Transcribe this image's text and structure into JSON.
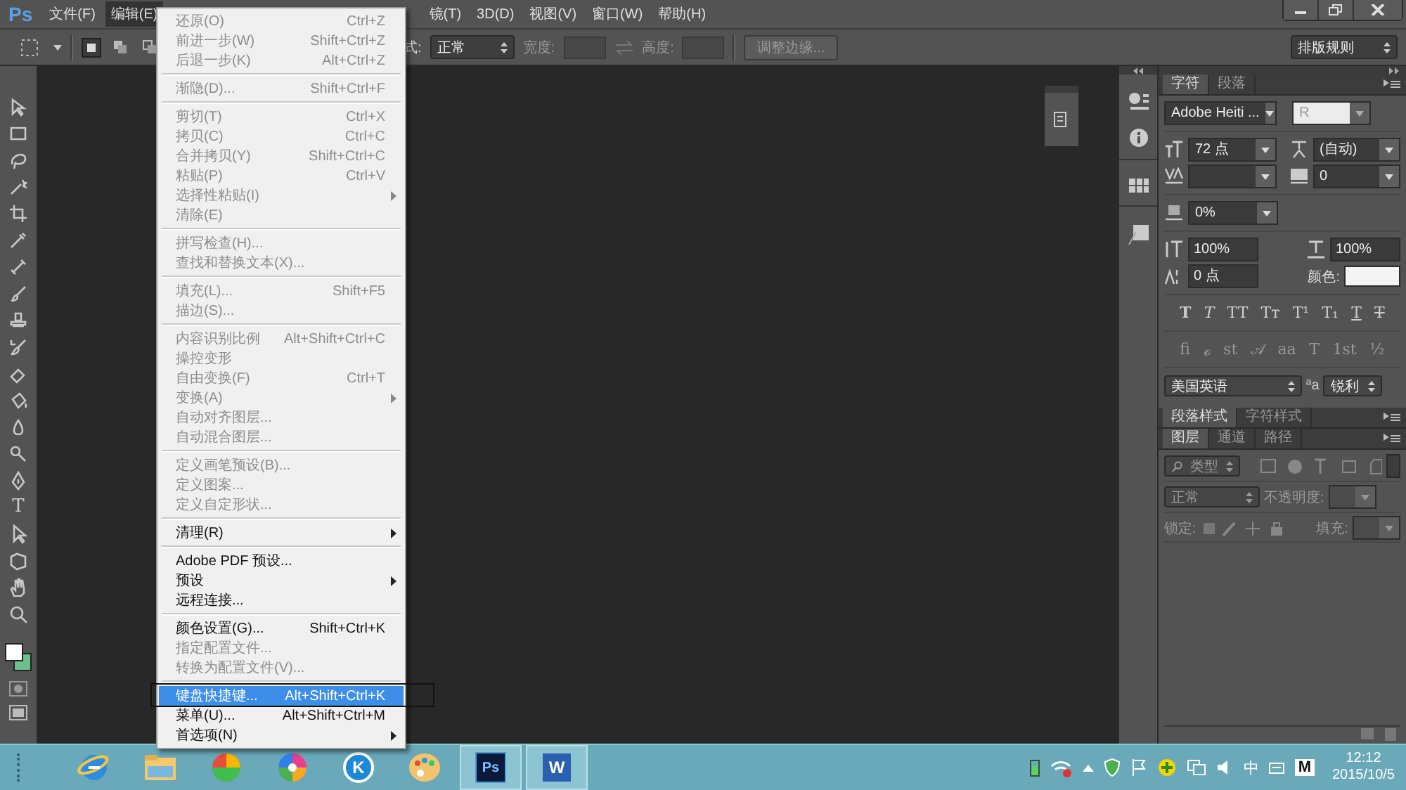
{
  "app": {
    "logo": "Ps"
  },
  "menubar": [
    {
      "label": "文件(F)",
      "selected": false
    },
    {
      "label": "编辑(E)",
      "selected": true
    },
    {
      "label": "镜(T)",
      "selected": false
    },
    {
      "label": "3D(D)",
      "selected": false
    },
    {
      "label": "视图(V)",
      "selected": false
    },
    {
      "label": "窗口(W)",
      "selected": false
    },
    {
      "label": "帮助(H)",
      "selected": false
    }
  ],
  "options_bar": {
    "style_label": "式:",
    "style_value": "正常",
    "width_label": "宽度:",
    "height_label": "高度:",
    "refine_button": "调整边缘...",
    "typography_select": "排版规则"
  },
  "edit_menu": {
    "groups": [
      {
        "items": [
          {
            "label": "还原(O)",
            "shortcut": "Ctrl+Z",
            "disabled": true,
            "submenu": false,
            "selected": false
          },
          {
            "label": "前进一步(W)",
            "shortcut": "Shift+Ctrl+Z",
            "disabled": true,
            "submenu": false,
            "selected": false
          },
          {
            "label": "后退一步(K)",
            "shortcut": "Alt+Ctrl+Z",
            "disabled": true,
            "submenu": false,
            "selected": false
          }
        ]
      },
      {
        "items": [
          {
            "label": "渐隐(D)...",
            "shortcut": "Shift+Ctrl+F",
            "disabled": true,
            "submenu": false,
            "selected": false
          }
        ]
      },
      {
        "items": [
          {
            "label": "剪切(T)",
            "shortcut": "Ctrl+X",
            "disabled": true,
            "submenu": false,
            "selected": false
          },
          {
            "label": "拷贝(C)",
            "shortcut": "Ctrl+C",
            "disabled": true,
            "submenu": false,
            "selected": false
          },
          {
            "label": "合并拷贝(Y)",
            "shortcut": "Shift+Ctrl+C",
            "disabled": true,
            "submenu": false,
            "selected": false
          },
          {
            "label": "粘贴(P)",
            "shortcut": "Ctrl+V",
            "disabled": true,
            "submenu": false,
            "selected": false
          },
          {
            "label": "选择性粘贴(I)",
            "disabled": true,
            "submenu": true,
            "selected": false
          },
          {
            "label": "清除(E)",
            "disabled": true,
            "submenu": false,
            "selected": false
          }
        ]
      },
      {
        "items": [
          {
            "label": "拼写检查(H)...",
            "disabled": true,
            "submenu": false,
            "selected": false
          },
          {
            "label": "查找和替换文本(X)...",
            "disabled": true,
            "submenu": false,
            "selected": false
          }
        ]
      },
      {
        "items": [
          {
            "label": "填充(L)...",
            "shortcut": "Shift+F5",
            "disabled": true,
            "submenu": false,
            "selected": false
          },
          {
            "label": "描边(S)...",
            "disabled": true,
            "submenu": false,
            "selected": false
          }
        ]
      },
      {
        "items": [
          {
            "label": "内容识别比例",
            "shortcut": "Alt+Shift+Ctrl+C",
            "disabled": true,
            "submenu": false,
            "selected": false
          },
          {
            "label": "操控变形",
            "disabled": true,
            "submenu": false,
            "selected": false
          },
          {
            "label": "自由变换(F)",
            "shortcut": "Ctrl+T",
            "disabled": true,
            "submenu": false,
            "selected": false
          },
          {
            "label": "变换(A)",
            "disabled": true,
            "submenu": true,
            "selected": false
          },
          {
            "label": "自动对齐图层...",
            "disabled": true,
            "submenu": false,
            "selected": false
          },
          {
            "label": "自动混合图层...",
            "disabled": true,
            "submenu": false,
            "selected": false
          }
        ]
      },
      {
        "items": [
          {
            "label": "定义画笔预设(B)...",
            "disabled": true,
            "submenu": false,
            "selected": false
          },
          {
            "label": "定义图案...",
            "disabled": true,
            "submenu": false,
            "selected": false
          },
          {
            "label": "定义自定形状...",
            "disabled": true,
            "submenu": false,
            "selected": false
          }
        ]
      },
      {
        "items": [
          {
            "label": "清理(R)",
            "disabled": false,
            "submenu": true,
            "selected": false
          }
        ]
      },
      {
        "items": [
          {
            "label": "Adobe PDF 预设...",
            "disabled": false,
            "submenu": false,
            "selected": false
          },
          {
            "label": "预设",
            "disabled": false,
            "submenu": true,
            "selected": false
          },
          {
            "label": "远程连接...",
            "disabled": false,
            "submenu": false,
            "selected": false
          }
        ]
      },
      {
        "items": [
          {
            "label": "颜色设置(G)...",
            "shortcut": "Shift+Ctrl+K",
            "disabled": false,
            "submenu": false,
            "selected": false
          },
          {
            "label": "指定配置文件...",
            "disabled": true,
            "submenu": false,
            "selected": false
          },
          {
            "label": "转换为配置文件(V)...",
            "disabled": true,
            "submenu": false,
            "selected": false
          }
        ]
      },
      {
        "items": [
          {
            "label": "键盘快捷键...",
            "shortcut": "Alt+Shift+Ctrl+K",
            "disabled": false,
            "submenu": false,
            "selected": true
          },
          {
            "label": "菜单(U)...",
            "shortcut": "Alt+Shift+Ctrl+M",
            "disabled": false,
            "submenu": false,
            "selected": false
          },
          {
            "label": "首选项(N)",
            "disabled": false,
            "submenu": true,
            "selected": false
          }
        ]
      }
    ]
  },
  "toolbar": {
    "type_glyph": "T"
  },
  "character_panel": {
    "tabs": [
      {
        "label": "字符",
        "selected": true
      },
      {
        "label": "段落",
        "selected": false
      }
    ],
    "font_family": "Adobe Heiti ...",
    "font_style": "R",
    "size": "72 点",
    "leading": "(自动)",
    "tracking": "0",
    "tsume": "0%",
    "vertical_scale": "100%",
    "horizontal_scale": "100%",
    "baseline_shift": "0 点",
    "color_label": "颜色:",
    "color": "#f4f4f4",
    "style_buttons": [
      {
        "glyph": "T",
        "kind": "bold"
      },
      {
        "glyph": "T",
        "kind": "italic"
      },
      {
        "glyph": "TT",
        "kind": "plain"
      },
      {
        "glyph": "Tт",
        "kind": "plain"
      },
      {
        "glyph": "T¹",
        "kind": "plain"
      },
      {
        "glyph": "T₁",
        "kind": "plain"
      },
      {
        "glyph": "T",
        "kind": "underline"
      },
      {
        "glyph": "T",
        "kind": "strike"
      }
    ],
    "opentype_buttons": [
      "ﬁ",
      "ℴ",
      "st",
      "𝒜",
      "aa",
      "T",
      "1st",
      "½"
    ],
    "language": "美国英语",
    "antialias_label": "ªa",
    "antialias": "锐利"
  },
  "style_tabs": [
    {
      "label": "段落样式",
      "selected": true
    },
    {
      "label": "字符样式",
      "selected": false
    }
  ],
  "layers_panel": {
    "tabs": [
      {
        "label": "图层",
        "selected": true
      },
      {
        "label": "通道",
        "selected": false
      },
      {
        "label": "路径",
        "selected": false
      }
    ],
    "filter": "类型",
    "blend_mode": "正常",
    "opacity_label": "不透明度:",
    "lock_label": "锁定:",
    "fill_label": "填充:"
  },
  "taskbar": {
    "apps": [
      {
        "kind": "browser",
        "active": false
      },
      {
        "kind": "folder",
        "active": false
      },
      {
        "kind": "ball",
        "active": false
      },
      {
        "kind": "pinwheel",
        "active": false
      },
      {
        "kind": "letter",
        "label": "K",
        "active": false
      },
      {
        "kind": "palette",
        "active": false
      },
      {
        "kind": "ps",
        "label": "Ps",
        "active": true
      },
      {
        "kind": "doc",
        "label": "W",
        "active": true
      }
    ],
    "ime": "中",
    "input_mode": "M",
    "time": "12:12",
    "date": "2015/10/5"
  }
}
